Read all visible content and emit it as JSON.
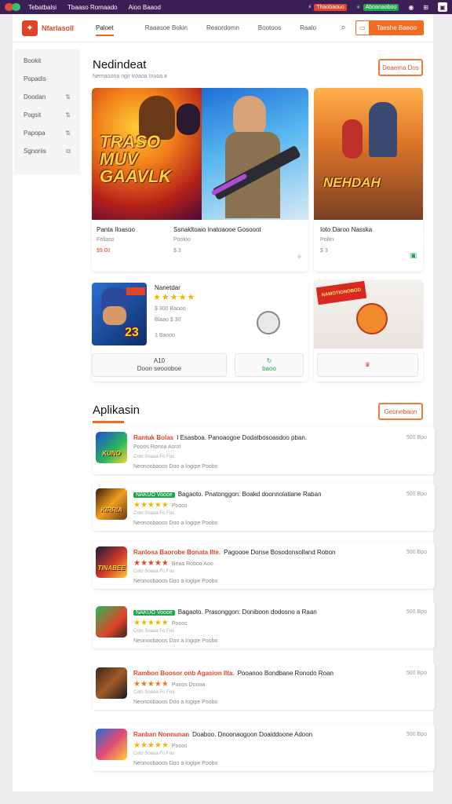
{
  "topbar": {
    "links": [
      "Tebatbalsi",
      "Tbaaso Romaado",
      "Aioo Baaod"
    ],
    "pills": [
      {
        "icon": "bolt-icon",
        "text": "Thaobaouo",
        "color": "#e0442a"
      },
      {
        "icon": "leaf-icon",
        "text": "Aboanaoboo",
        "color": "#1fa64a"
      }
    ],
    "icons": [
      "github-icon",
      "grid-icon",
      "window-icon"
    ]
  },
  "header": {
    "brand": "Nfarlasoll",
    "nav": [
      "Paloet",
      "Raaasoe Bokin",
      "Reaordomn",
      "Bootoos",
      "Raalo"
    ],
    "active_nav": "Paloet",
    "button_label": "Taeshe Baeoo",
    "accent": "#f26b22"
  },
  "sidebar": {
    "items": [
      {
        "label": "Bookit",
        "icon": ""
      },
      {
        "label": "Popadis",
        "icon": ""
      },
      {
        "label": "Doodan",
        "icon": "⇅"
      },
      {
        "label": "Pogsit",
        "icon": "⇅"
      },
      {
        "label": "Papopa",
        "icon": "⇅"
      },
      {
        "label": "Sgnoriis",
        "icon": "⧉"
      }
    ]
  },
  "featured": {
    "title": "Nedindeat",
    "subtitle": "Nemaoona ngir Iroaoa Inuoa a",
    "button": "Deaema Dos",
    "cards": [
      {
        "art_text": "TRASO\nMUV\nGAAVLK",
        "name": "Panta Iloasoo",
        "meta": "Fellaso",
        "price": "$9.00"
      },
      {
        "name": "Ssnakltoaio Inatoaooe Gosooot",
        "meta": "Pooloo",
        "price": "$ 3",
        "corner": "✧"
      },
      {
        "art_text": "NEHDAH",
        "name": "Ioto Daroo Nasska",
        "meta": "Pollin",
        "price": "$ 3",
        "corner": "▣"
      }
    ],
    "mid_card": {
      "name": "Nanetdar",
      "art_text": "23",
      "rating": "★★★★★",
      "line1": "$ 300 Baooo",
      "line2": "Blaao  $ 30",
      "line3": "1 Baooo",
      "btn_left_top": "A10",
      "btn_left_bottom": "Doon seoooboe",
      "btn_right": "baoo"
    },
    "promo": {
      "banner": "NAMOTIONOBOD"
    }
  },
  "apps": {
    "title": "Aplikasin",
    "button": "Geonebaon",
    "rows": [
      {
        "icon_text": "KUNO",
        "name": "Rantuk Bolas",
        "title": "I Esasboa. Panoaogoe Dodatbosoasdoo pban.",
        "sub": "Pooos Ronoa Asrot",
        "sub2": "Coto Soaoa Fo Foo",
        "foot": "Neonoobaoos  Doo  a Iogipe  Poobo",
        "size": "500 Bpo"
      },
      {
        "icon_text": "KIRRIA",
        "name": "NAKUO Voooe",
        "badge": true,
        "title": "Bagaoto. Pnatonggon: Boakd doonnolatiane Raban",
        "sub": "Pooos",
        "sub2": "Coto Soaoa Fo Foo",
        "foot": "Neonoobaoos  Doo  a Iogipe  Poobo",
        "size": "500 Bpo"
      },
      {
        "icon_text": "TINABEE",
        "name": "Ranlosa Baorobe Bonata Ilte.",
        "title": "Pagoooe Donse Bosodonsolland Robon",
        "sub": "Beaa Roboa Aoo",
        "sub2": "Coto Soaoa Fo Foo",
        "foot": "Neonoobaoos  Doo  a Iogipe  Poobo",
        "size": "500 Bpo"
      },
      {
        "icon_text": "",
        "name": "NAKUO Voooe",
        "badge": true,
        "title": "Bagaoto. Prasonggon: Doniboon dodosno a Raan",
        "sub": "Pooos",
        "sub2": "Coto Soaoa Fo Foo",
        "foot": "Neonoobaoos  Doo  a Iogipe  Poobo",
        "size": "500 Bpo"
      },
      {
        "icon_text": "",
        "name": "Rambon Boosor onb Agasion Ilta.",
        "title": "Pooanoo Bondbane Ronodo Roan",
        "sub": "Pooos Doooa",
        "sub2": "Coto Soaoa Fo Foo",
        "foot": "Neonoobaoos  Doo  a Iogipe  Poobo",
        "size": "500 Bpo"
      },
      {
        "icon_text": "",
        "name": "Ranban Nonnunan",
        "title": "Doaboo. Dnoonaogoon Doaiddoone Adoon",
        "sub": "Pooos",
        "sub2": "Coto Soaoa Fo Foo",
        "foot": "Neonoobaoos  Doo  a Iogipe  Poobo",
        "size": "500 Bpo"
      }
    ]
  }
}
